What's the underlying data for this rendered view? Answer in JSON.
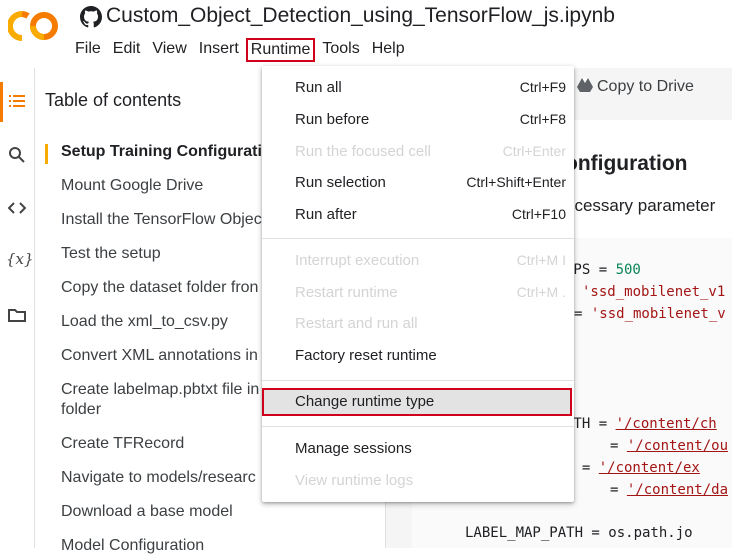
{
  "app": {
    "notebook_title": "Custom_Object_Detection_using_TensorFlow_js.ipynb",
    "colors": {
      "accent_orange": "#f57c00",
      "highlight_red": "#d0021b",
      "logo_yellow": "#f9ab00"
    }
  },
  "menubar": {
    "items": [
      "File",
      "Edit",
      "View",
      "Insert",
      "Runtime",
      "Tools",
      "Help"
    ],
    "active": "Runtime"
  },
  "rail": {
    "icons": [
      "toc-icon",
      "search-icon",
      "code-snippets-icon",
      "variables-icon",
      "files-icon"
    ],
    "variables_glyph": "{x}"
  },
  "toc": {
    "title": "Table of contents",
    "items": [
      "Setup Training Configuratio",
      "Mount Google Drive",
      "Install the TensorFlow Objec",
      "Test the setup",
      "Copy the dataset folder fron",
      "Load the xml_to_csv.py",
      "Convert XML annotations in",
      "Create labelmap.pbtxt file in",
      "folder",
      "Create TFRecord",
      "Navigate to models/researc",
      "Download a base model",
      "Model Configuration"
    ]
  },
  "toolbar": {
    "copy_to_drive": "Copy to Drive"
  },
  "cell": {
    "heading": "onfiguration",
    "text": "ecessary parameter",
    "code": {
      "l1_a": "EPS = ",
      "l1_b": "500",
      "l2": "'ssd_mobilenet_v1",
      "l3_a": "= ",
      "l3_b": "'ssd_mobilenet_v",
      "l4_a": "ATH = ",
      "l4_b": "'/content/ch",
      "l5_a": "= ",
      "l5_b": "'/content/ou",
      "l6_a": "H   = ",
      "l6_b": "'/content/ex",
      "l7_a": "= ",
      "l7_b": "'/content/da",
      "l8": "LABEL_MAP_PATH    = os.path.jo"
    }
  },
  "runtime_menu": {
    "items": [
      {
        "label": "Run all",
        "shortcut": "Ctrl+F9",
        "disabled": false
      },
      {
        "label": "Run before",
        "shortcut": "Ctrl+F8",
        "disabled": false
      },
      {
        "label": "Run the focused cell",
        "shortcut": "Ctrl+Enter",
        "disabled": true
      },
      {
        "label": "Run selection",
        "shortcut": "Ctrl+Shift+Enter",
        "disabled": false
      },
      {
        "label": "Run after",
        "shortcut": "Ctrl+F10",
        "disabled": false
      },
      {
        "label": "Interrupt execution",
        "shortcut": "Ctrl+M I",
        "disabled": true
      },
      {
        "label": "Restart runtime",
        "shortcut": "Ctrl+M .",
        "disabled": true
      },
      {
        "label": "Restart and run all",
        "shortcut": "",
        "disabled": true
      },
      {
        "label": "Factory reset runtime",
        "shortcut": "",
        "disabled": false
      },
      {
        "label": "Change runtime type",
        "shortcut": "",
        "disabled": false,
        "highlighted": true
      },
      {
        "label": "Manage sessions",
        "shortcut": "",
        "disabled": false
      },
      {
        "label": "View runtime logs",
        "shortcut": "",
        "disabled": true
      }
    ]
  }
}
